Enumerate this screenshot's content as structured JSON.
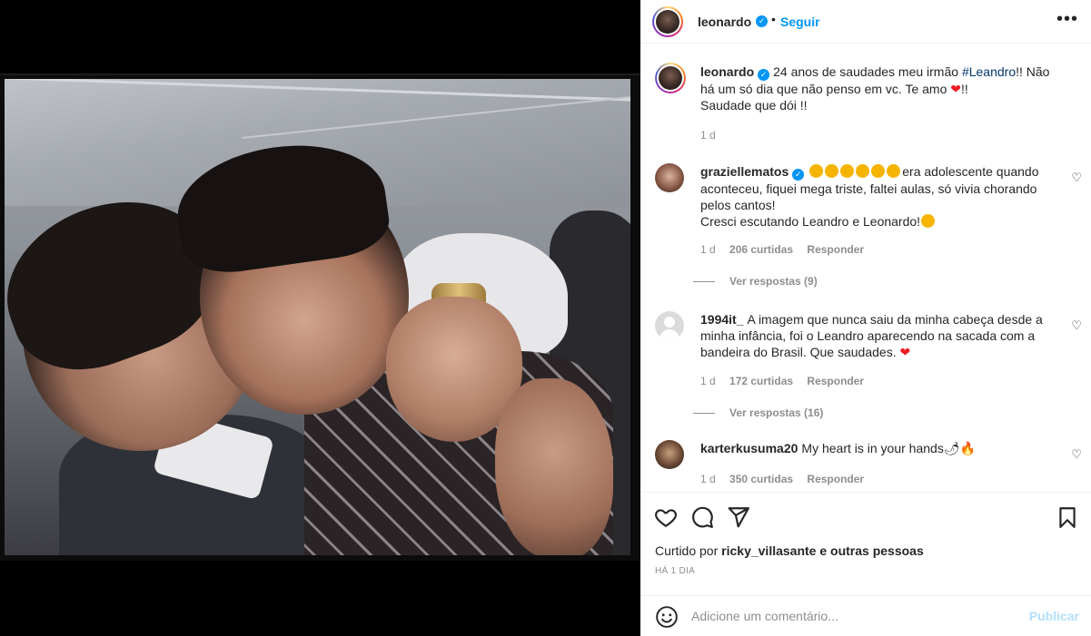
{
  "post": {
    "author": "leonardo",
    "follow_label": "Seguir",
    "dot": "•",
    "more_label": "•••"
  },
  "caption": {
    "username": "leonardo",
    "text_before_tag": "24 anos de saudades meu irmão ",
    "hashtag": "#Leandro",
    "text_after_tag": "!! Não há um só dia que não penso em vc. Te amo ",
    "heart": "❤",
    "text_after_heart": "!!",
    "line2": "Saudade que dói !!",
    "time": "1 d"
  },
  "comments": [
    {
      "username": "graziellematos",
      "verified": true,
      "text_after_emojis": "era adolescente quando aconteceu, fiquei mega triste, faltei aulas, só vivia chorando pelos cantos!",
      "line2": "Cresci escutando Leandro e Leonardo!",
      "time": "1 d",
      "likes": "206 curtidas",
      "reply_label": "Responder",
      "view_replies": "Ver respostas (9)"
    },
    {
      "username": "1994it_",
      "verified": false,
      "text": "A imagem que nunca saiu da minha cabeça desde a minha infância, foi o Leandro aparecendo na sacada com a bandeira do Brasil. Que saudades. ",
      "heart": "❤",
      "time": "1 d",
      "likes": "172 curtidas",
      "reply_label": "Responder",
      "view_replies": "Ver respostas (16)"
    },
    {
      "username": "karterkusuma20",
      "verified": false,
      "text": "My heart is in your hands🌶🔥",
      "time": "1 d",
      "likes": "350 curtidas",
      "reply_label": "Responder"
    }
  ],
  "engagement": {
    "liked_by_prefix": "Curtido por ",
    "liked_by_user": "ricky_villasante",
    "liked_by_suffix": " e outras pessoas",
    "time_ago": "HÁ 1 DIA"
  },
  "composer": {
    "placeholder": "Adicione um comentário...",
    "publish_label": "Publicar"
  },
  "icons": {
    "like": "heart-outline-icon",
    "comment": "comment-bubble-icon",
    "share": "paper-plane-icon",
    "save": "bookmark-icon",
    "emoji": "smiley-icon",
    "verified": "verified-badge-icon"
  },
  "colors": {
    "accent_blue": "#0095f6",
    "hashtag": "#00376b",
    "heart_red": "#ed1c24",
    "publish_disabled": "#b2dffc"
  }
}
